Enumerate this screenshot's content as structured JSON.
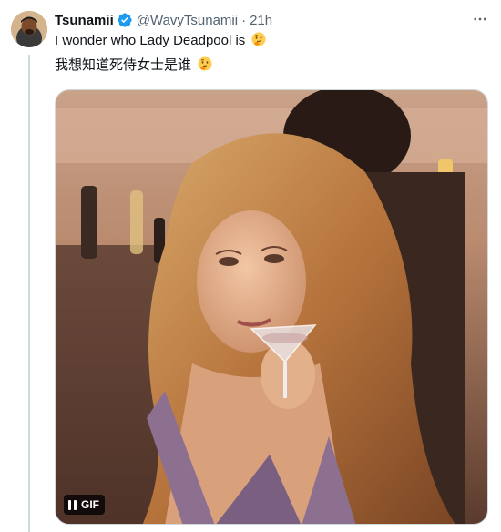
{
  "tweet": {
    "display_name": "Tsunamii",
    "handle": "@WavyTsunamii",
    "separator": "·",
    "time": "21h",
    "text_line1": "I wonder who Lady Deadpool is",
    "text_line2": "我想知道死侍女士是谁",
    "emoji": "thinking-face"
  },
  "media": {
    "type": "gif",
    "badge_label": "GIF",
    "control": "pause-icon"
  },
  "colors": {
    "verified": "#1d9bf0",
    "muted_text": "#536471",
    "thread_line": "#cfd9de"
  }
}
